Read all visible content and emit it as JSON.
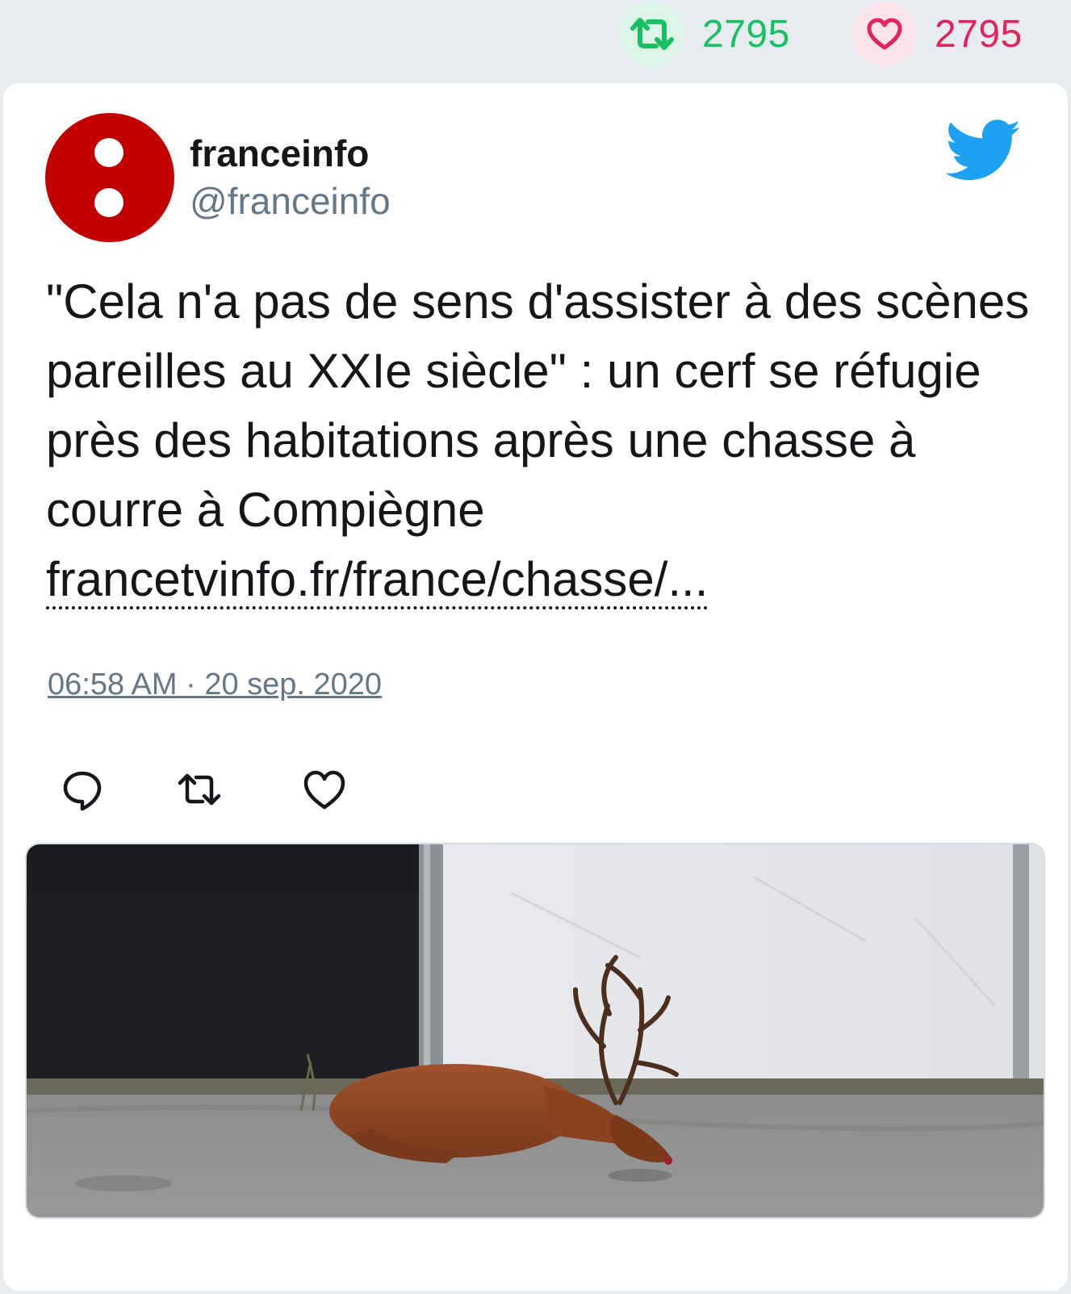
{
  "stats": {
    "retweet_count": "2795",
    "like_count": "2795"
  },
  "author": {
    "display_name": "franceinfo",
    "handle": "@franceinfo"
  },
  "tweet": {
    "text": "\"Cela n'a pas de sens d'assister à des scènes pareilles au XXIe siècle\" : un cerf se réfugie près des habitations après une chasse à courre à Compiègne ",
    "link_text": "francetvinfo.fr/france/chasse/...",
    "timestamp": "06:58 AM · 20 sep. 2020"
  },
  "icons": {
    "retweet": "retweet-icon",
    "like": "heart-icon",
    "reply": "reply-icon",
    "brand": "twitter-bird-icon",
    "avatar": "franceinfo-logo"
  },
  "colors": {
    "retweet": "#19bf63",
    "like": "#e0245e",
    "twitter_blue": "#1da1f2",
    "avatar_red": "#c20000",
    "handle_gray": "#657786"
  }
}
